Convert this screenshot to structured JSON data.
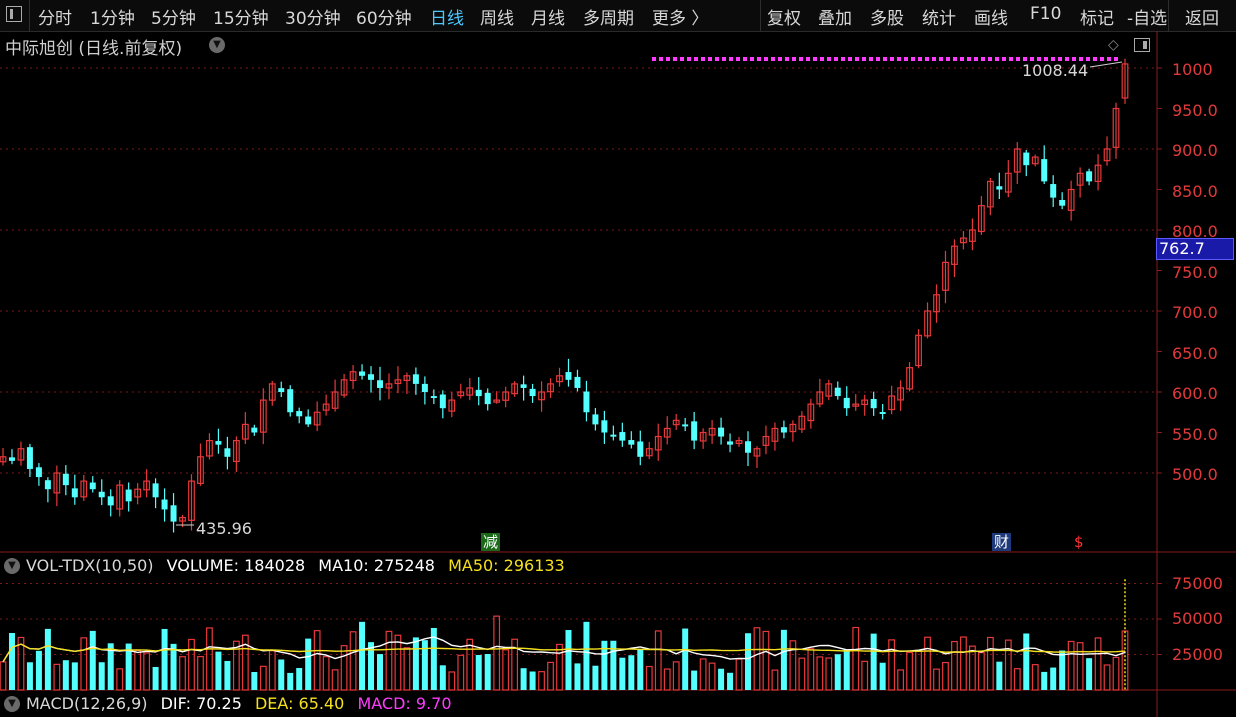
{
  "toolbar": {
    "left_items": [
      {
        "label": "分时",
        "active": false
      },
      {
        "label": "1分钟",
        "active": false
      },
      {
        "label": "5分钟",
        "active": false
      },
      {
        "label": "15分钟",
        "active": false
      },
      {
        "label": "30分钟",
        "active": false
      },
      {
        "label": "60分钟",
        "active": false
      },
      {
        "label": "日线",
        "active": true
      },
      {
        "label": "周线",
        "active": false
      },
      {
        "label": "月线",
        "active": false
      },
      {
        "label": "多周期",
        "active": false
      },
      {
        "label": "更多 〉",
        "active": false
      }
    ],
    "right_items": [
      "复权",
      "叠加",
      "多股",
      "统计",
      "画线",
      "F10",
      "标记",
      "-自选",
      "返回"
    ]
  },
  "stock": {
    "title": "中际旭创 (日线.前复权)"
  },
  "price_axis": {
    "labels": [
      "1000",
      "950.0",
      "900.0",
      "850.0",
      "800.0",
      "750.0",
      "700.0",
      "650.0",
      "600.0",
      "550.0",
      "500.0"
    ],
    "current_price": "762.7"
  },
  "annotations": {
    "high": "1008.44",
    "low": "435.96"
  },
  "markers": {
    "reduce": "减",
    "finance": "财",
    "dollar": "$"
  },
  "volume": {
    "indicator": "VOL-TDX(10,50)",
    "volume": "VOLUME: 184028",
    "ma10": "MA10: 275248",
    "ma50": "MA50: 296133",
    "axis_labels": [
      "75000",
      "50000",
      "25000"
    ]
  },
  "macd": {
    "indicator": "MACD(12,26,9)",
    "dif": "DIF: 70.25",
    "dea": "DEA: 65.40",
    "macd": "MACD: 9.70"
  },
  "colors": {
    "up": "#e8393a",
    "down": "#54ffff",
    "ma10": "#ffffff",
    "ma50": "#f5e01e",
    "magenta": "#ff3cff",
    "axis_red": "#e03a3a",
    "active_tab": "#4cc8ff"
  },
  "chart_data": {
    "type": "candlestick",
    "closes": [
      520,
      515,
      530,
      505,
      495,
      480,
      500,
      485,
      470,
      490,
      480,
      470,
      460,
      485,
      465,
      480,
      490,
      470,
      455,
      440,
      445,
      490,
      520,
      540,
      535,
      520,
      540,
      560,
      550,
      590,
      610,
      600,
      575,
      570,
      560,
      575,
      585,
      600,
      615,
      625,
      620,
      615,
      605,
      610,
      615,
      620,
      610,
      600,
      595,
      580,
      590,
      600,
      605,
      595,
      585,
      590,
      600,
      610,
      605,
      595,
      600,
      610,
      620,
      615,
      605,
      575,
      560,
      550,
      545,
      540,
      535,
      520,
      530,
      545,
      555,
      565,
      560,
      540,
      550,
      555,
      545,
      535,
      540,
      525,
      530,
      545,
      555,
      550,
      560,
      570,
      585,
      600,
      610,
      595,
      580,
      585,
      590,
      580,
      575,
      595,
      605,
      630,
      670,
      700,
      720,
      760,
      780,
      790,
      800,
      830,
      860,
      850,
      870,
      900,
      880,
      890,
      860,
      840,
      830,
      850,
      870,
      860,
      880,
      900,
      950,
      963
    ]
  }
}
